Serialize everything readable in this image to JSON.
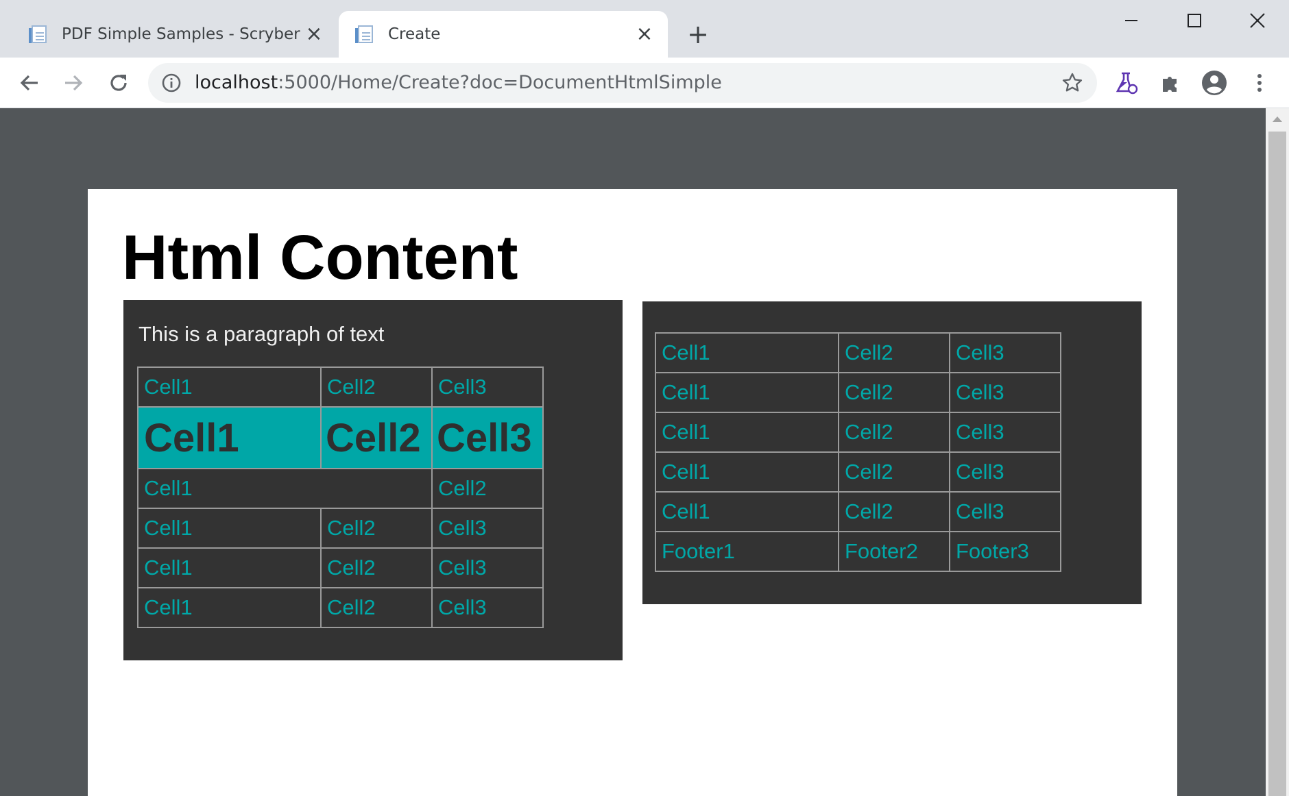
{
  "browser": {
    "tabs": [
      {
        "title": "PDF Simple Samples - Scryber",
        "active": false
      },
      {
        "title": "Create",
        "active": true
      }
    ],
    "address": {
      "host": "localhost",
      "rest": ":5000/Home/Create?doc=DocumentHtmlSimple"
    },
    "colors": {
      "tabstrip": "#dee1e6",
      "omnibox": "#f1f3f4",
      "lab_icon": "#5e35b1"
    }
  },
  "document": {
    "heading": "Html Content",
    "left_panel": {
      "paragraph": "This is a paragraph of text",
      "rows": [
        [
          "Cell1",
          "Cell2",
          "Cell3"
        ],
        [
          "Cell1",
          "Cell2",
          "Cell3"
        ],
        [
          "Cell1",
          "Cell2"
        ],
        [
          "Cell1",
          "Cell2",
          "Cell3"
        ],
        [
          "Cell1",
          "Cell2",
          "Cell3"
        ],
        [
          "Cell1",
          "Cell2",
          "Cell3"
        ]
      ],
      "highlight_row": 1,
      "spanned_row": 2
    },
    "right_panel": {
      "rows": [
        [
          "Cell1",
          "Cell2",
          "Cell3"
        ],
        [
          "Cell1",
          "Cell2",
          "Cell3"
        ],
        [
          "Cell1",
          "Cell2",
          "Cell3"
        ],
        [
          "Cell1",
          "Cell2",
          "Cell3"
        ],
        [
          "Cell1",
          "Cell2",
          "Cell3"
        ]
      ],
      "footer": [
        "Footer1",
        "Footer2",
        "Footer3"
      ]
    },
    "colors": {
      "panel_bg": "#333333",
      "cell_text": "#00a8a8",
      "highlight_bg": "#00a7a7",
      "cell_border": "#9a9a9a"
    }
  }
}
